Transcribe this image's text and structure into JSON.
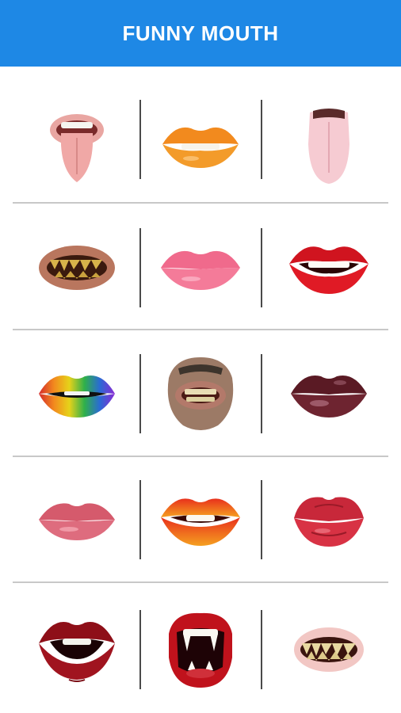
{
  "header": {
    "title": "FUNNY MOUTH"
  },
  "colors": {
    "appbar": "#1e88e5",
    "divider": "#c8c8c8",
    "separator": "#4a4a4a"
  },
  "mouths": [
    [
      {
        "name": "tongue-out-mouth-icon"
      },
      {
        "name": "orange-lips-icon"
      },
      {
        "name": "tongue-icon"
      }
    ],
    [
      {
        "name": "rotten-teeth-mouth-icon"
      },
      {
        "name": "pink-lips-icon"
      },
      {
        "name": "red-smiling-lips-icon"
      }
    ],
    [
      {
        "name": "rainbow-lips-icon"
      },
      {
        "name": "bearded-mouth-icon"
      },
      {
        "name": "dark-glossy-lips-icon"
      }
    ],
    [
      {
        "name": "soft-pink-lips-icon"
      },
      {
        "name": "orange-red-lips-icon"
      },
      {
        "name": "red-kiss-lips-icon"
      }
    ],
    [
      {
        "name": "dark-red-open-lips-icon"
      },
      {
        "name": "vampire-fangs-icon"
      },
      {
        "name": "monster-teeth-icon"
      }
    ]
  ]
}
